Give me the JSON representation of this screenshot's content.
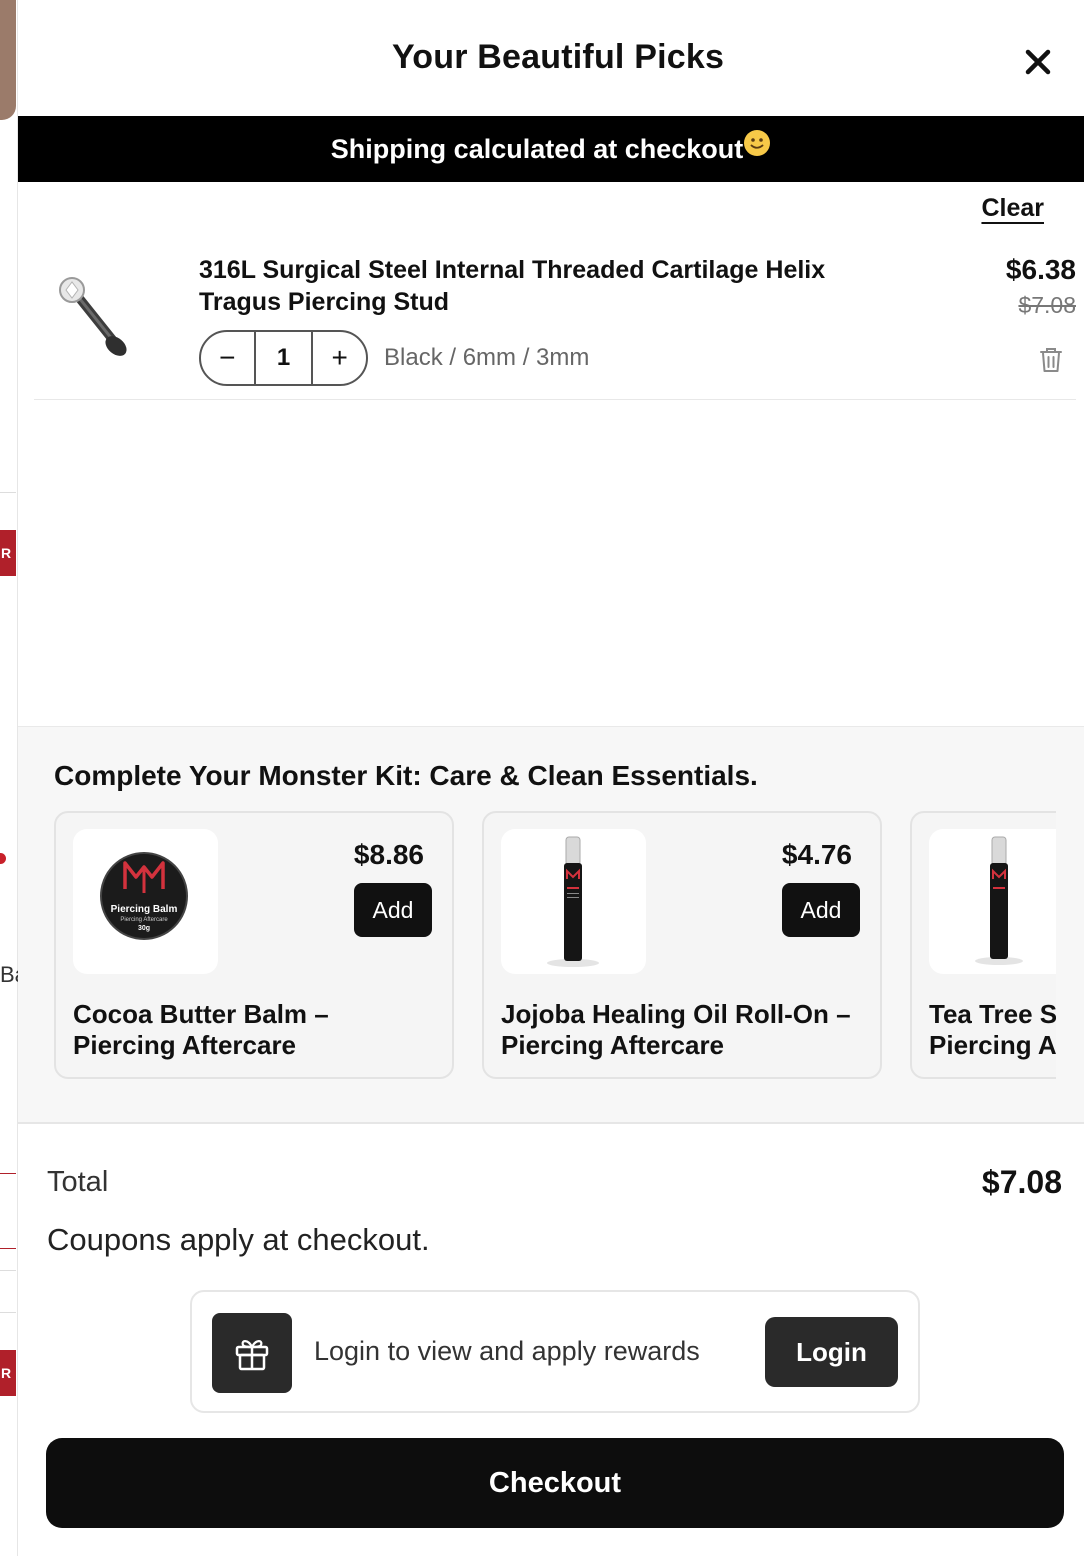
{
  "background": {
    "tag_letter_1": "R",
    "tag_letter_2": "R",
    "partial_text": "Ba"
  },
  "header": {
    "title": "Your Beautiful Picks",
    "close_icon": "close-icon"
  },
  "shipping_bar": {
    "text": "Shipping calculated at checkout",
    "emoji_icon": "smile-emoji-icon"
  },
  "cart": {
    "clear_label": "Clear",
    "items": [
      {
        "name": "316L Surgical Steel Internal Threaded Cartilage Helix Tragus Piercing Stud",
        "quantity": "1",
        "decrement_label": "−",
        "increment_label": "+",
        "variant": "Black / 6mm / 3mm",
        "price": "$6.38",
        "original_price": "$7.08",
        "remove_icon": "trash-icon"
      }
    ]
  },
  "upsell": {
    "title": "Complete Your Monster Kit: Care & Clean Essentials.",
    "products": [
      {
        "name": "Cocoa Butter Balm – Piercing Aftercare",
        "price": "$8.86",
        "add_label": "Add",
        "image_text": [
          "Piercing Balm",
          "Piercing Aftercare",
          "30g"
        ]
      },
      {
        "name": "Jojoba Healing Oil Roll-On – Piercing Aftercare",
        "price": "$4.76",
        "add_label": "Add"
      },
      {
        "name": "Tea Tree S Piercing A",
        "name_line1": "Tea Tree S",
        "name_line2": "Piercing A"
      }
    ]
  },
  "totals": {
    "label": "Total",
    "value": "$7.08",
    "coupon_note": "Coupons apply at checkout."
  },
  "rewards": {
    "text": "Login to view and apply rewards",
    "login_label": "Login",
    "icon": "gift-icon"
  },
  "checkout": {
    "label": "Checkout"
  },
  "colors": {
    "accent": "#0d0d0d",
    "brand_red": "#b0202a",
    "muted": "#777777"
  }
}
